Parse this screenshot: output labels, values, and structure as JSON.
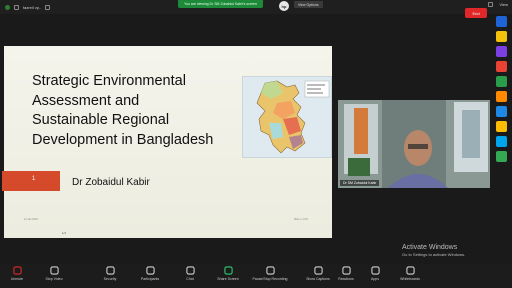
{
  "topbar": {
    "meeting_name": "fazrell vp..",
    "share_banner": "You are viewing Dr SM Zobaidul Kabir's screen",
    "hp_logo": "hp",
    "view_options": "View Options",
    "view_label": "View"
  },
  "slide": {
    "title_lines": [
      "Strategic Environmental",
      "Assessment and",
      "Sustainable Regional",
      "Development in Bangladesh"
    ],
    "slide_number": "1",
    "author": "Dr Zobaidul Kabir",
    "footer_left": "12 Jan 2023",
    "footer_right": "Slide 1 of 20",
    "page_indicator": "1/1"
  },
  "video": {
    "name": "Dr SM Zobaidul Kabir"
  },
  "sidebar": {
    "apps": [
      {
        "name": "app-icon-1",
        "color": "#1e64d6"
      },
      {
        "name": "app-icon-2",
        "color": "#f4c20d"
      },
      {
        "name": "app-icon-3",
        "color": "#7b3fe4"
      },
      {
        "name": "app-icon-4",
        "color": "#e94335"
      },
      {
        "name": "app-icon-5",
        "color": "#2a9d4b"
      },
      {
        "name": "app-icon-6",
        "color": "#ff8a00"
      },
      {
        "name": "app-icon-7",
        "color": "#1e88e5"
      },
      {
        "name": "app-icon-8",
        "color": "#fbbc04"
      },
      {
        "name": "app-icon-9",
        "color": "#00a6ed"
      },
      {
        "name": "app-icon-10",
        "color": "#34a853"
      }
    ]
  },
  "watermark": {
    "line1": "Activate Windows",
    "line2": "Go to Settings to activate Windows."
  },
  "toolbar": {
    "tools": [
      {
        "name": "unmute-button",
        "label": "Unmute",
        "icon": "mic-off-icon",
        "color": "#e02828"
      },
      {
        "name": "stop-video-button",
        "label": "Stop Video",
        "icon": "video-icon",
        "color": "#cfcfcf"
      },
      {
        "name": "security-button",
        "label": "Security",
        "icon": "shield-icon",
        "color": "#cfcfcf"
      },
      {
        "name": "participants-button",
        "label": "Participants",
        "icon": "people-icon",
        "color": "#cfcfcf"
      },
      {
        "name": "chat-button",
        "label": "Chat",
        "icon": "chat-icon",
        "color": "#cfcfcf"
      },
      {
        "name": "share-screen-button",
        "label": "Share Screen",
        "icon": "share-icon",
        "color": "#2ecc71"
      },
      {
        "name": "record-button",
        "label": "Pause/Stop Recording",
        "icon": "record-icon",
        "color": "#cfcfcf"
      },
      {
        "name": "show-captions-button",
        "label": "Show Captions",
        "icon": "cc-icon",
        "color": "#cfcfcf"
      },
      {
        "name": "reactions-button",
        "label": "Reactions",
        "icon": "smile-icon",
        "color": "#cfcfcf"
      },
      {
        "name": "apps-button",
        "label": "Apps",
        "icon": "apps-icon",
        "color": "#cfcfcf"
      },
      {
        "name": "whiteboards-button",
        "label": "Whiteboards",
        "icon": "whiteboard-icon",
        "color": "#cfcfcf"
      }
    ],
    "end_label": "End"
  }
}
